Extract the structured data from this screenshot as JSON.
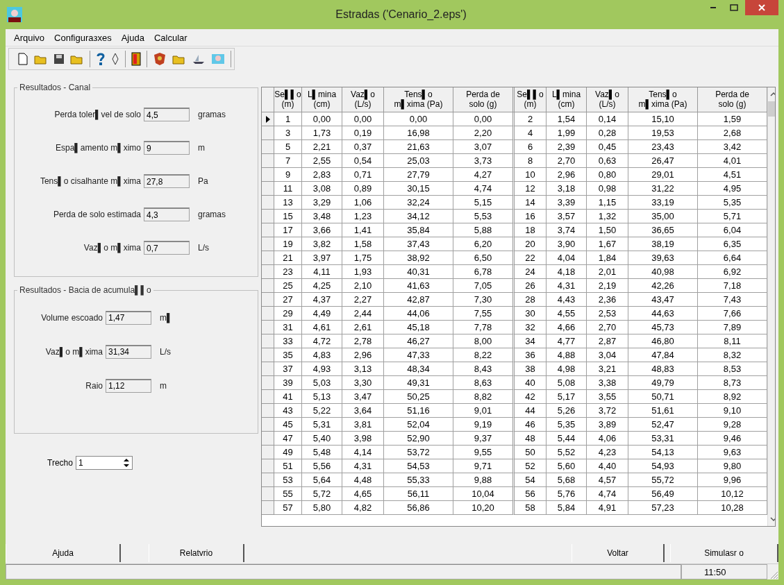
{
  "window": {
    "title": "Estradas ('Cenario_2.eps')"
  },
  "menu": [
    "Arquivo",
    "Configuraзxes",
    "Ajuda",
    "Calcular"
  ],
  "canal": {
    "title": "Resultados - Canal",
    "fields": [
      {
        "label": "Perda toler▌vel de solo",
        "value": "4,5",
        "unit": "gramas"
      },
      {
        "label": "Espa▌amento m▌ximo",
        "value": "9",
        "unit": "m"
      },
      {
        "label": "Tens▌o cisalhante m▌xima",
        "value": "27,8",
        "unit": "Pa"
      },
      {
        "label": "Perda de solo estimada",
        "value": "4,3",
        "unit": "gramas"
      },
      {
        "label": "Vaz▌o m▌xima",
        "value": "0,7",
        "unit": "L/s"
      }
    ]
  },
  "bacia": {
    "title": "Resultados - Bacia de acumula▌▌o",
    "fields": [
      {
        "label": "Volume escoado",
        "value": "1,47",
        "unit": "m▌"
      },
      {
        "label": "Vaz▌o m▌xima",
        "value": "31,34",
        "unit": "L/s"
      },
      {
        "label": "Raio",
        "value": "1,12",
        "unit": "m"
      }
    ]
  },
  "trecho": {
    "label": "Trecho",
    "value": "1"
  },
  "table": {
    "columns": [
      {
        "title": "Se▌▌o",
        "unit": "(m)"
      },
      {
        "title": "L▌mina",
        "unit": "(cm)"
      },
      {
        "title": "Vaz▌o",
        "unit": "(L/s)"
      },
      {
        "title": "Tens▌o",
        "unit": "m▌xima (Pa)"
      },
      {
        "title": "Perda de",
        "unit": "solo (g)"
      },
      {
        "title": "Se▌▌o",
        "unit": "(m)"
      },
      {
        "title": "L▌mina",
        "unit": "(cm)"
      },
      {
        "title": "Vaz▌o",
        "unit": "(L/s)"
      },
      {
        "title": "Tens▌o",
        "unit": "m▌xima (Pa)"
      },
      {
        "title": "Perda de",
        "unit": "solo (g)"
      }
    ],
    "rows": [
      {
        "selected": true,
        "cells": [
          "1",
          "0,00",
          "0,00",
          "0,00",
          "0,00",
          "2",
          "1,54",
          "0,14",
          "15,10",
          "1,59"
        ]
      },
      {
        "selected": false,
        "cells": [
          "3",
          "1,73",
          "0,19",
          "16,98",
          "2,20",
          "4",
          "1,99",
          "0,28",
          "19,53",
          "2,68"
        ]
      },
      {
        "selected": false,
        "cells": [
          "5",
          "2,21",
          "0,37",
          "21,63",
          "3,07",
          "6",
          "2,39",
          "0,45",
          "23,43",
          "3,42"
        ]
      },
      {
        "selected": false,
        "cells": [
          "7",
          "2,55",
          "0,54",
          "25,03",
          "3,73",
          "8",
          "2,70",
          "0,63",
          "26,47",
          "4,01"
        ]
      },
      {
        "selected": false,
        "cells": [
          "9",
          "2,83",
          "0,71",
          "27,79",
          "4,27",
          "10",
          "2,96",
          "0,80",
          "29,01",
          "4,51"
        ]
      },
      {
        "selected": false,
        "cells": [
          "11",
          "3,08",
          "0,89",
          "30,15",
          "4,74",
          "12",
          "3,18",
          "0,98",
          "31,22",
          "4,95"
        ]
      },
      {
        "selected": false,
        "cells": [
          "13",
          "3,29",
          "1,06",
          "32,24",
          "5,15",
          "14",
          "3,39",
          "1,15",
          "33,19",
          "5,35"
        ]
      },
      {
        "selected": false,
        "cells": [
          "15",
          "3,48",
          "1,23",
          "34,12",
          "5,53",
          "16",
          "3,57",
          "1,32",
          "35,00",
          "5,71"
        ]
      },
      {
        "selected": false,
        "cells": [
          "17",
          "3,66",
          "1,41",
          "35,84",
          "5,88",
          "18",
          "3,74",
          "1,50",
          "36,65",
          "6,04"
        ]
      },
      {
        "selected": false,
        "cells": [
          "19",
          "3,82",
          "1,58",
          "37,43",
          "6,20",
          "20",
          "3,90",
          "1,67",
          "38,19",
          "6,35"
        ]
      },
      {
        "selected": false,
        "cells": [
          "21",
          "3,97",
          "1,75",
          "38,92",
          "6,50",
          "22",
          "4,04",
          "1,84",
          "39,63",
          "6,64"
        ]
      },
      {
        "selected": false,
        "cells": [
          "23",
          "4,11",
          "1,93",
          "40,31",
          "6,78",
          "24",
          "4,18",
          "2,01",
          "40,98",
          "6,92"
        ]
      },
      {
        "selected": false,
        "cells": [
          "25",
          "4,25",
          "2,10",
          "41,63",
          "7,05",
          "26",
          "4,31",
          "2,19",
          "42,26",
          "7,18"
        ]
      },
      {
        "selected": false,
        "cells": [
          "27",
          "4,37",
          "2,27",
          "42,87",
          "7,30",
          "28",
          "4,43",
          "2,36",
          "43,47",
          "7,43"
        ]
      },
      {
        "selected": false,
        "cells": [
          "29",
          "4,49",
          "2,44",
          "44,06",
          "7,55",
          "30",
          "4,55",
          "2,53",
          "44,63",
          "7,66"
        ]
      },
      {
        "selected": false,
        "cells": [
          "31",
          "4,61",
          "2,61",
          "45,18",
          "7,78",
          "32",
          "4,66",
          "2,70",
          "45,73",
          "7,89"
        ]
      },
      {
        "selected": false,
        "cells": [
          "33",
          "4,72",
          "2,78",
          "46,27",
          "8,00",
          "34",
          "4,77",
          "2,87",
          "46,80",
          "8,11"
        ]
      },
      {
        "selected": false,
        "cells": [
          "35",
          "4,83",
          "2,96",
          "47,33",
          "8,22",
          "36",
          "4,88",
          "3,04",
          "47,84",
          "8,32"
        ]
      },
      {
        "selected": false,
        "cells": [
          "37",
          "4,93",
          "3,13",
          "48,34",
          "8,43",
          "38",
          "4,98",
          "3,21",
          "48,83",
          "8,53"
        ]
      },
      {
        "selected": false,
        "cells": [
          "39",
          "5,03",
          "3,30",
          "49,31",
          "8,63",
          "40",
          "5,08",
          "3,38",
          "49,79",
          "8,73"
        ]
      },
      {
        "selected": false,
        "cells": [
          "41",
          "5,13",
          "3,47",
          "50,25",
          "8,82",
          "42",
          "5,17",
          "3,55",
          "50,71",
          "8,92"
        ]
      },
      {
        "selected": false,
        "cells": [
          "43",
          "5,22",
          "3,64",
          "51,16",
          "9,01",
          "44",
          "5,26",
          "3,72",
          "51,61",
          "9,10"
        ]
      },
      {
        "selected": false,
        "cells": [
          "45",
          "5,31",
          "3,81",
          "52,04",
          "9,19",
          "46",
          "5,35",
          "3,89",
          "52,47",
          "9,28"
        ]
      },
      {
        "selected": false,
        "cells": [
          "47",
          "5,40",
          "3,98",
          "52,90",
          "9,37",
          "48",
          "5,44",
          "4,06",
          "53,31",
          "9,46"
        ]
      },
      {
        "selected": false,
        "cells": [
          "49",
          "5,48",
          "4,14",
          "53,72",
          "9,55",
          "50",
          "5,52",
          "4,23",
          "54,13",
          "9,63"
        ]
      },
      {
        "selected": false,
        "cells": [
          "51",
          "5,56",
          "4,31",
          "54,53",
          "9,71",
          "52",
          "5,60",
          "4,40",
          "54,93",
          "9,80"
        ]
      },
      {
        "selected": false,
        "cells": [
          "53",
          "5,64",
          "4,48",
          "55,33",
          "9,88",
          "54",
          "5,68",
          "4,57",
          "55,72",
          "9,96"
        ]
      },
      {
        "selected": false,
        "cells": [
          "55",
          "5,72",
          "4,65",
          "56,11",
          "10,04",
          "56",
          "5,76",
          "4,74",
          "56,49",
          "10,12"
        ]
      },
      {
        "selected": false,
        "cells": [
          "57",
          "5,80",
          "4,82",
          "56,86",
          "10,20",
          "58",
          "5,84",
          "4,91",
          "57,23",
          "10,28"
        ]
      }
    ]
  },
  "buttons_left": [
    "Ajuda",
    "Relatvrio"
  ],
  "buttons_right": [
    "Voltar",
    "Simulasr o"
  ],
  "status_bar": {
    "time": "11:50"
  }
}
